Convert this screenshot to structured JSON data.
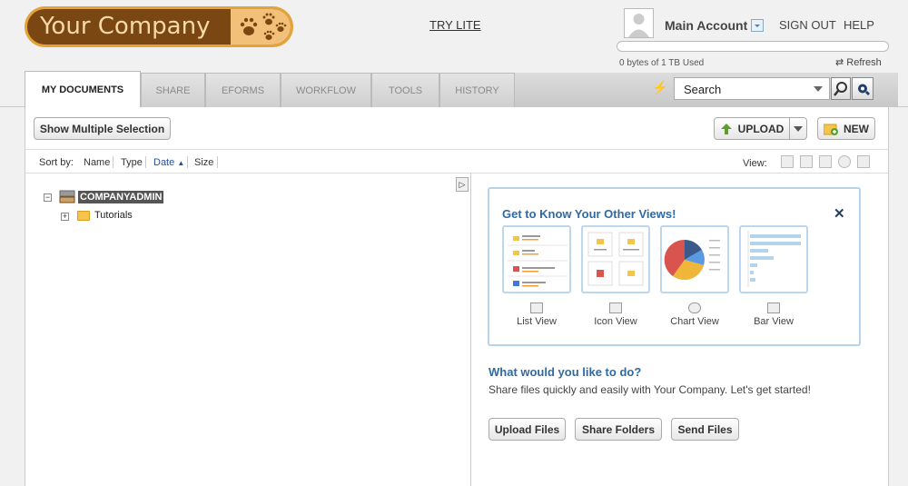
{
  "header": {
    "logo_text": "Your Company",
    "try_lite": "TRY LITE",
    "account_name": "Main Account",
    "sign_out": "SIGN OUT",
    "help": "HELP",
    "storage_used_text": "0 bytes of 1 TB Used",
    "storage_used_fraction": 0,
    "refresh": "Refresh"
  },
  "tabs": [
    {
      "label": "MY DOCUMENTS",
      "active": true
    },
    {
      "label": "SHARE",
      "active": false
    },
    {
      "label": "EFORMS",
      "active": false
    },
    {
      "label": "WORKFLOW",
      "active": false
    },
    {
      "label": "TOOLS",
      "active": false
    },
    {
      "label": "HISTORY",
      "active": false
    }
  ],
  "search": {
    "value": "Search"
  },
  "toolbar": {
    "show_multiple": "Show Multiple Selection",
    "upload": "UPLOAD",
    "new": "NEW"
  },
  "sort": {
    "label": "Sort by:",
    "options": [
      "Name",
      "Type",
      "Date",
      "Size"
    ],
    "active": "Date",
    "direction": "ascending",
    "view_label": "View:"
  },
  "tree": {
    "root": "COMPANYADMIN",
    "children": [
      "Tutorials"
    ]
  },
  "views_panel": {
    "title": "Get to Know Your Other Views!",
    "views": [
      "List View",
      "Icon View",
      "Chart View",
      "Bar View"
    ]
  },
  "getting_started": {
    "title": "What would you like to do?",
    "subtitle": "Share files quickly and easily with Your Company. Let's get started!",
    "buttons": [
      "Upload Files",
      "Share Folders",
      "Send Files"
    ]
  },
  "colors": {
    "brand_brown": "#7a4712",
    "brand_orange": "#e3a23a",
    "link_blue": "#2d6aa6",
    "panel_border": "#b6d3ec"
  }
}
